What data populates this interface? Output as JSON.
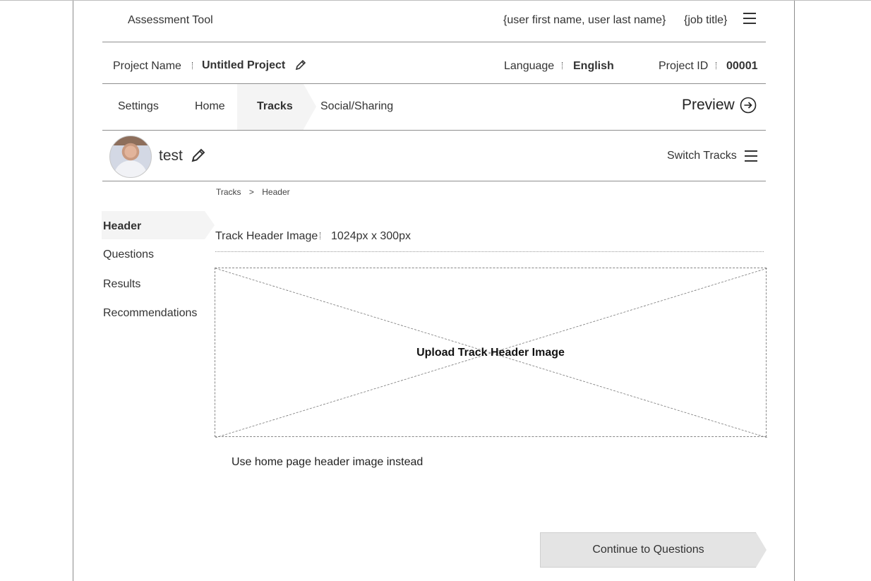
{
  "app": {
    "title": "Assessment Tool",
    "user_name": "{user first name, user last name}",
    "job_title": "{job title}"
  },
  "project": {
    "name_label": "Project Name",
    "name_value": "Untitled Project",
    "language_label": "Language",
    "language_value": "English",
    "id_label": "Project ID",
    "id_value": "00001"
  },
  "tabs": [
    {
      "label": "Settings"
    },
    {
      "label": "Home"
    },
    {
      "label": "Tracks",
      "active": true
    },
    {
      "label": "Social/Sharing"
    }
  ],
  "preview_label": "Preview",
  "track": {
    "name": "test",
    "switch_label": "Switch Tracks"
  },
  "breadcrumb": {
    "root": "Tracks",
    "separator": ">",
    "current": "Header"
  },
  "sidebar": {
    "items": [
      {
        "label": "Header",
        "active": true
      },
      {
        "label": "Questions"
      },
      {
        "label": "Results"
      },
      {
        "label": "Recommendations"
      }
    ]
  },
  "content": {
    "field_label": "Track Header Image",
    "field_value": "1024px x 300px",
    "upload_label": "Upload Track Header Image",
    "use_home_label": "Use home page header image instead",
    "continue_label": "Continue to Questions"
  },
  "icons": {
    "menu": "hamburger-icon",
    "edit": "pencil-icon",
    "preview": "arrow-circle-right-icon"
  }
}
